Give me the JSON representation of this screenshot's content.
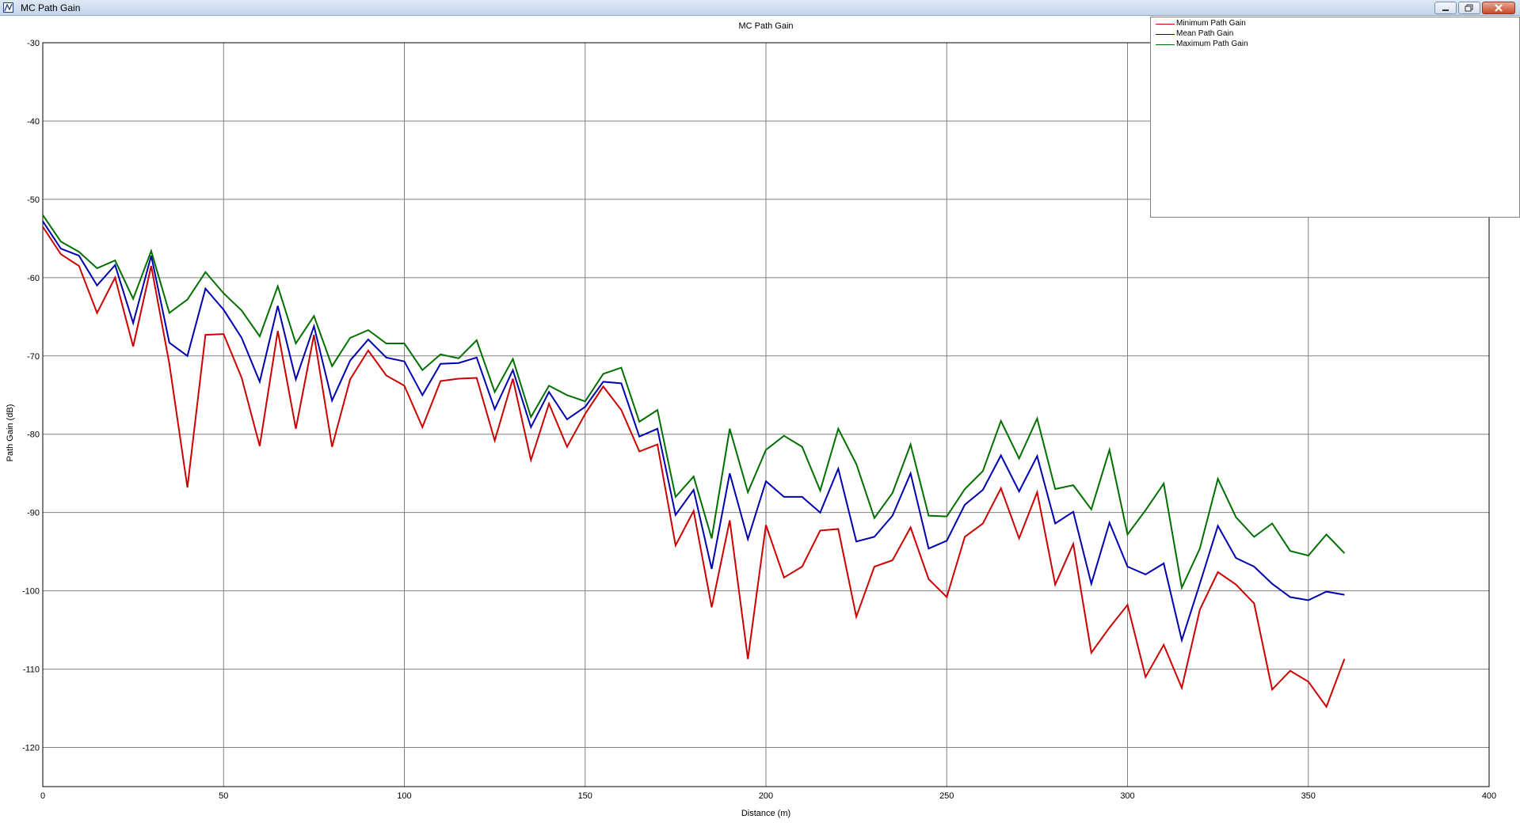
{
  "window": {
    "title": "MC Path Gain"
  },
  "chart_data": {
    "type": "line",
    "title": "MC Path Gain",
    "xlabel": "Distance (m)",
    "ylabel": "Path Gain (dB)",
    "xlim": [
      0,
      400
    ],
    "ylim": [
      -125,
      -30
    ],
    "xticks": [
      0,
      50,
      100,
      150,
      200,
      250,
      300,
      350,
      400
    ],
    "yticks": [
      -30,
      -40,
      -50,
      -60,
      -70,
      -80,
      -90,
      -100,
      -110,
      -120
    ],
    "grid": true,
    "legend_position": "top-right",
    "x": [
      0,
      5,
      10,
      15,
      20,
      25,
      30,
      35,
      40,
      45,
      50,
      55,
      60,
      65,
      70,
      75,
      80,
      85,
      90,
      95,
      100,
      105,
      110,
      115,
      120,
      125,
      130,
      135,
      140,
      145,
      150,
      155,
      160,
      165,
      170,
      175,
      180,
      185,
      190,
      195,
      200,
      205,
      210,
      215,
      220,
      225,
      230,
      235,
      240,
      245,
      250,
      255,
      260,
      265,
      270,
      275,
      280,
      285,
      290,
      295,
      300,
      305,
      310,
      315,
      320,
      325,
      330,
      335,
      340,
      345,
      350,
      355,
      360
    ],
    "series": [
      {
        "name": "Minimum Path Gain",
        "color": "#cc0000",
        "values": [
          -53.5,
          -57,
          -58.5,
          -64.5,
          -60,
          -68.8,
          -58.5,
          -71,
          -86.8,
          -67.3,
          -67.2,
          -72.8,
          -81.5,
          -66.8,
          -79.3,
          -67.3,
          -81.6,
          -73,
          -69.3,
          -72.5,
          -73.8,
          -79.1,
          -73.2,
          -72.9,
          -72.8,
          -80.8,
          -72.9,
          -83.3,
          -76.1,
          -81.6,
          -77.4,
          -73.9,
          -76.9,
          -82.2,
          -81.3,
          -94.2,
          -89.8,
          -102.1,
          -91,
          -108.7,
          -91.6,
          -98.3,
          -96.9,
          -92.3,
          -92.1,
          -103.3,
          -96.9,
          -96.1,
          -91.9,
          -98.5,
          -100.8,
          -93.1,
          -91.4,
          -86.9,
          -93.3,
          -87.4,
          -99.2,
          -94,
          -107.9,
          -104.7,
          -101.8,
          -111,
          -106.9,
          -112.4,
          -102.4,
          -97.6,
          -99.2,
          -101.6,
          -112.6,
          -110.2,
          -111.6,
          -114.8,
          -108.7
        ]
      },
      {
        "name": "Mean Path Gain",
        "color": "#0000b0",
        "values": [
          -52.8,
          -56.3,
          -57.2,
          -61,
          -58.4,
          -65.8,
          -57.2,
          -68.3,
          -70,
          -61.4,
          -64.1,
          -67.7,
          -73.3,
          -63.6,
          -73,
          -66.2,
          -75.7,
          -70.6,
          -67.9,
          -70.2,
          -70.7,
          -75,
          -71,
          -70.9,
          -70.2,
          -76.8,
          -71.8,
          -79.1,
          -74.6,
          -78.1,
          -76.5,
          -73.3,
          -73.5,
          -80.3,
          -79.3,
          -90.3,
          -87.1,
          -97.2,
          -85,
          -93.4,
          -86,
          -88,
          -88,
          -90,
          -84.4,
          -93.7,
          -93.1,
          -90.4,
          -85,
          -94.6,
          -93.6,
          -89,
          -87.1,
          -82.7,
          -87.3,
          -82.8,
          -91.4,
          -89.9,
          -99.1,
          -91.3,
          -96.9,
          -97.9,
          -96.5,
          -106.3,
          -99.1,
          -91.7,
          -95.8,
          -96.9,
          -99.1,
          -100.8,
          -101.2,
          -100.1,
          -100.5
        ]
      },
      {
        "name": "Maximum Path Gain",
        "color": "#007000",
        "values": [
          -52,
          -55.4,
          -56.7,
          -58.8,
          -57.8,
          -62.7,
          -56.6,
          -64.5,
          -62.8,
          -59.3,
          -62,
          -64.2,
          -67.5,
          -61.1,
          -68.4,
          -64.9,
          -71.3,
          -67.7,
          -66.7,
          -68.4,
          -68.4,
          -71.8,
          -69.8,
          -70.3,
          -68,
          -74.6,
          -70.4,
          -77.8,
          -73.8,
          -75,
          -75.8,
          -72.3,
          -71.5,
          -78.4,
          -76.9,
          -88,
          -85.4,
          -93.3,
          -79.3,
          -87.4,
          -82,
          -80.2,
          -81.6,
          -87.2,
          -79.3,
          -83.8,
          -90.7,
          -87.5,
          -81.3,
          -90.4,
          -90.5,
          -87,
          -84.7,
          -78.3,
          -83.1,
          -78,
          -87,
          -86.5,
          -89.6,
          -82,
          -92.8,
          -89.7,
          -86.3,
          -99.6,
          -94.6,
          -85.7,
          -90.6,
          -93.1,
          -91.4,
          -94.9,
          -95.5,
          -92.8,
          -95.2
        ]
      }
    ]
  }
}
